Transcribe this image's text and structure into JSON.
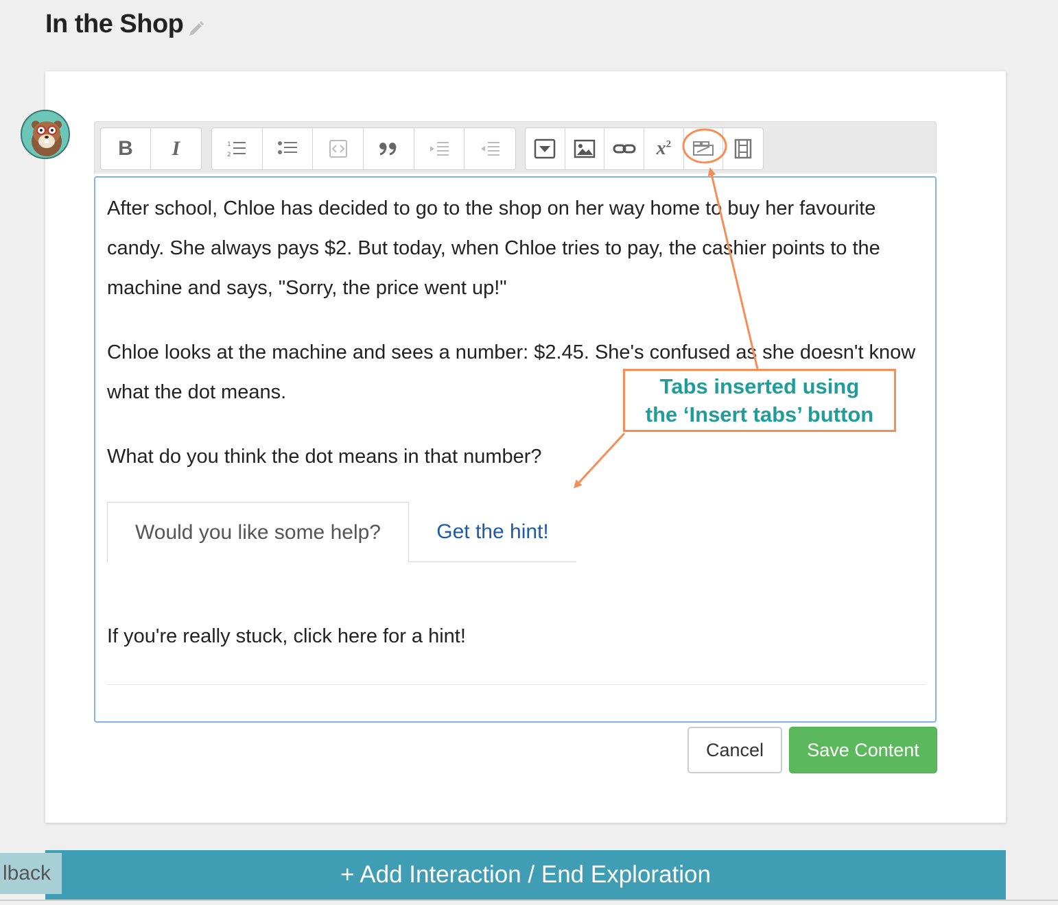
{
  "header": {
    "title": "In the Shop"
  },
  "toolbar": {
    "groups": [
      [
        "bold-icon",
        "italic-icon"
      ],
      [
        "numbered-list-icon",
        "bulleted-list-icon",
        "code-block-icon",
        "blockquote-icon",
        "indent-icon",
        "outdent-icon"
      ],
      [
        "collapsible-icon",
        "image-icon",
        "link-icon",
        "math-formula-icon",
        "tabs-icon",
        "video-icon"
      ]
    ],
    "bold_label": "B",
    "italic_label": "I",
    "superscript_label": "x",
    "superscript_exp": "2"
  },
  "editor": {
    "paragraph1": "After school, Chloe has decided to go to the shop on her way home to buy her favourite candy. She always pays $2. But today, when Chloe tries to pay, the cashier points to the machine and says, \"Sorry, the price went up!\"",
    "paragraph2": "Chloe looks at the machine and sees a number: $2.45. She's confused as she doesn't know what the dot means.",
    "paragraph3": "What do you think the dot means in that number?",
    "tabs": [
      {
        "label": "Would you like some help?",
        "active": true
      },
      {
        "label": "Get the hint!",
        "active": false
      }
    ],
    "tab_content": "If you're really stuck, click here for a hint!"
  },
  "actions": {
    "cancel_label": "Cancel",
    "save_label": "Save Content"
  },
  "add_interaction_label": "+ Add Interaction / End Exploration",
  "feedback_label": "lback",
  "annotation": {
    "line1": "Tabs inserted using",
    "line2": "the ‘Insert  tabs’ button"
  },
  "colors": {
    "accent_bar": "#3f9eb3",
    "save_button": "#5cb85c",
    "annotation_orange": "#f58d55",
    "annotation_text": "#1f9d99",
    "link_blue": "#1e5aa8",
    "editor_border": "#7fb4e8"
  }
}
